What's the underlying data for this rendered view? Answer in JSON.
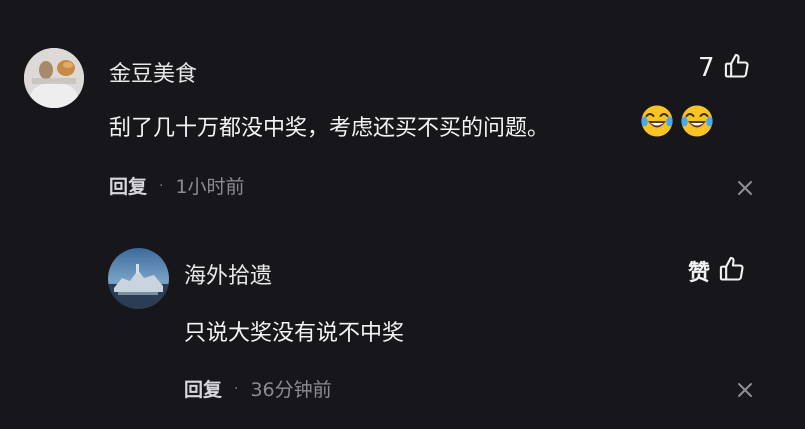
{
  "comments": [
    {
      "username": "金豆美食",
      "text": "刮了几十万都没中奖，考虑还买不买的问题。",
      "reply_label": "回复",
      "separator": "·",
      "time": "1小时前",
      "like_count": "7",
      "emojis": [
        "laughing-crying-emoji",
        "laughing-crying-emoji"
      ]
    },
    {
      "username": "海外拾遗",
      "text": "只说大奖没有说不中奖",
      "reply_label": "回复",
      "separator": "·",
      "time": "36分钟前",
      "like_label": "赞"
    }
  ],
  "colors": {
    "background": "#17171b",
    "text_primary": "#f4f4f6",
    "text_secondary": "#8b8b92",
    "emoji_face": "#f7c325"
  },
  "icons": [
    "thumbs-up-icon",
    "close-icon"
  ]
}
